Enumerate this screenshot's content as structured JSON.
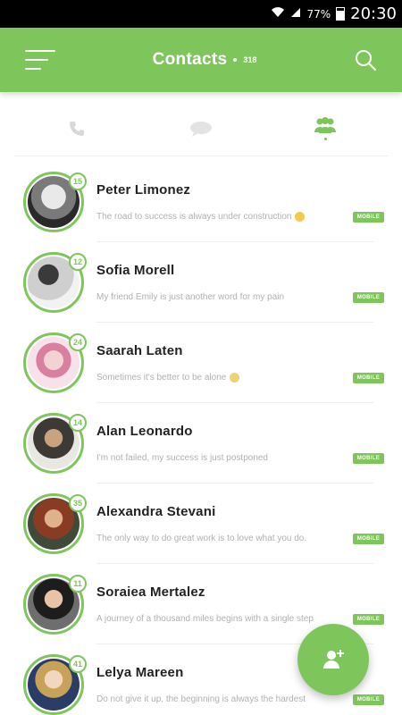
{
  "status_bar": {
    "battery": "77%",
    "time": "20:30"
  },
  "header": {
    "title": "Contacts",
    "count": "318"
  },
  "tabs": [
    {
      "name": "calls",
      "icon": "phone-icon",
      "active": false
    },
    {
      "name": "messages",
      "icon": "chat-icon",
      "active": false
    },
    {
      "name": "contacts",
      "icon": "group-icon",
      "active": true
    }
  ],
  "contacts": [
    {
      "name": "Peter Limonez",
      "status": "The road to success is always under construction",
      "emoji": "smile",
      "badge": "15",
      "type": "MOBILE"
    },
    {
      "name": "Sofia Morell",
      "status": "My friend Emily is just another word for my pain",
      "emoji": "",
      "badge": "12",
      "type": "MOBILE"
    },
    {
      "name": "Saarah Laten",
      "status": "Sometimes it's better to be alone",
      "emoji": "sad",
      "badge": "24",
      "type": "MOBILE"
    },
    {
      "name": "Alan Leonardo",
      "status": "I'm not failed, my success is just postponed",
      "emoji": "",
      "badge": "14",
      "type": "MOBILE"
    },
    {
      "name": "Alexandra Stevani",
      "status": "The only way to do great work is to love what you do.",
      "emoji": "",
      "badge": "35",
      "type": "MOBILE"
    },
    {
      "name": "Soraiea Mertalez",
      "status": "A journey of a thousand miles begins with a single step",
      "emoji": "",
      "badge": "11",
      "type": "MOBILE"
    },
    {
      "name": "Lelya Mareen",
      "status": "Do not give it up, the beginning is always the hardest",
      "emoji": "",
      "badge": "41",
      "type": "MOBILE"
    }
  ],
  "colors": {
    "accent": "#7ec65c",
    "title_text": "#ffffff",
    "name_text": "#222222",
    "status_text": "#b0b0b0"
  }
}
